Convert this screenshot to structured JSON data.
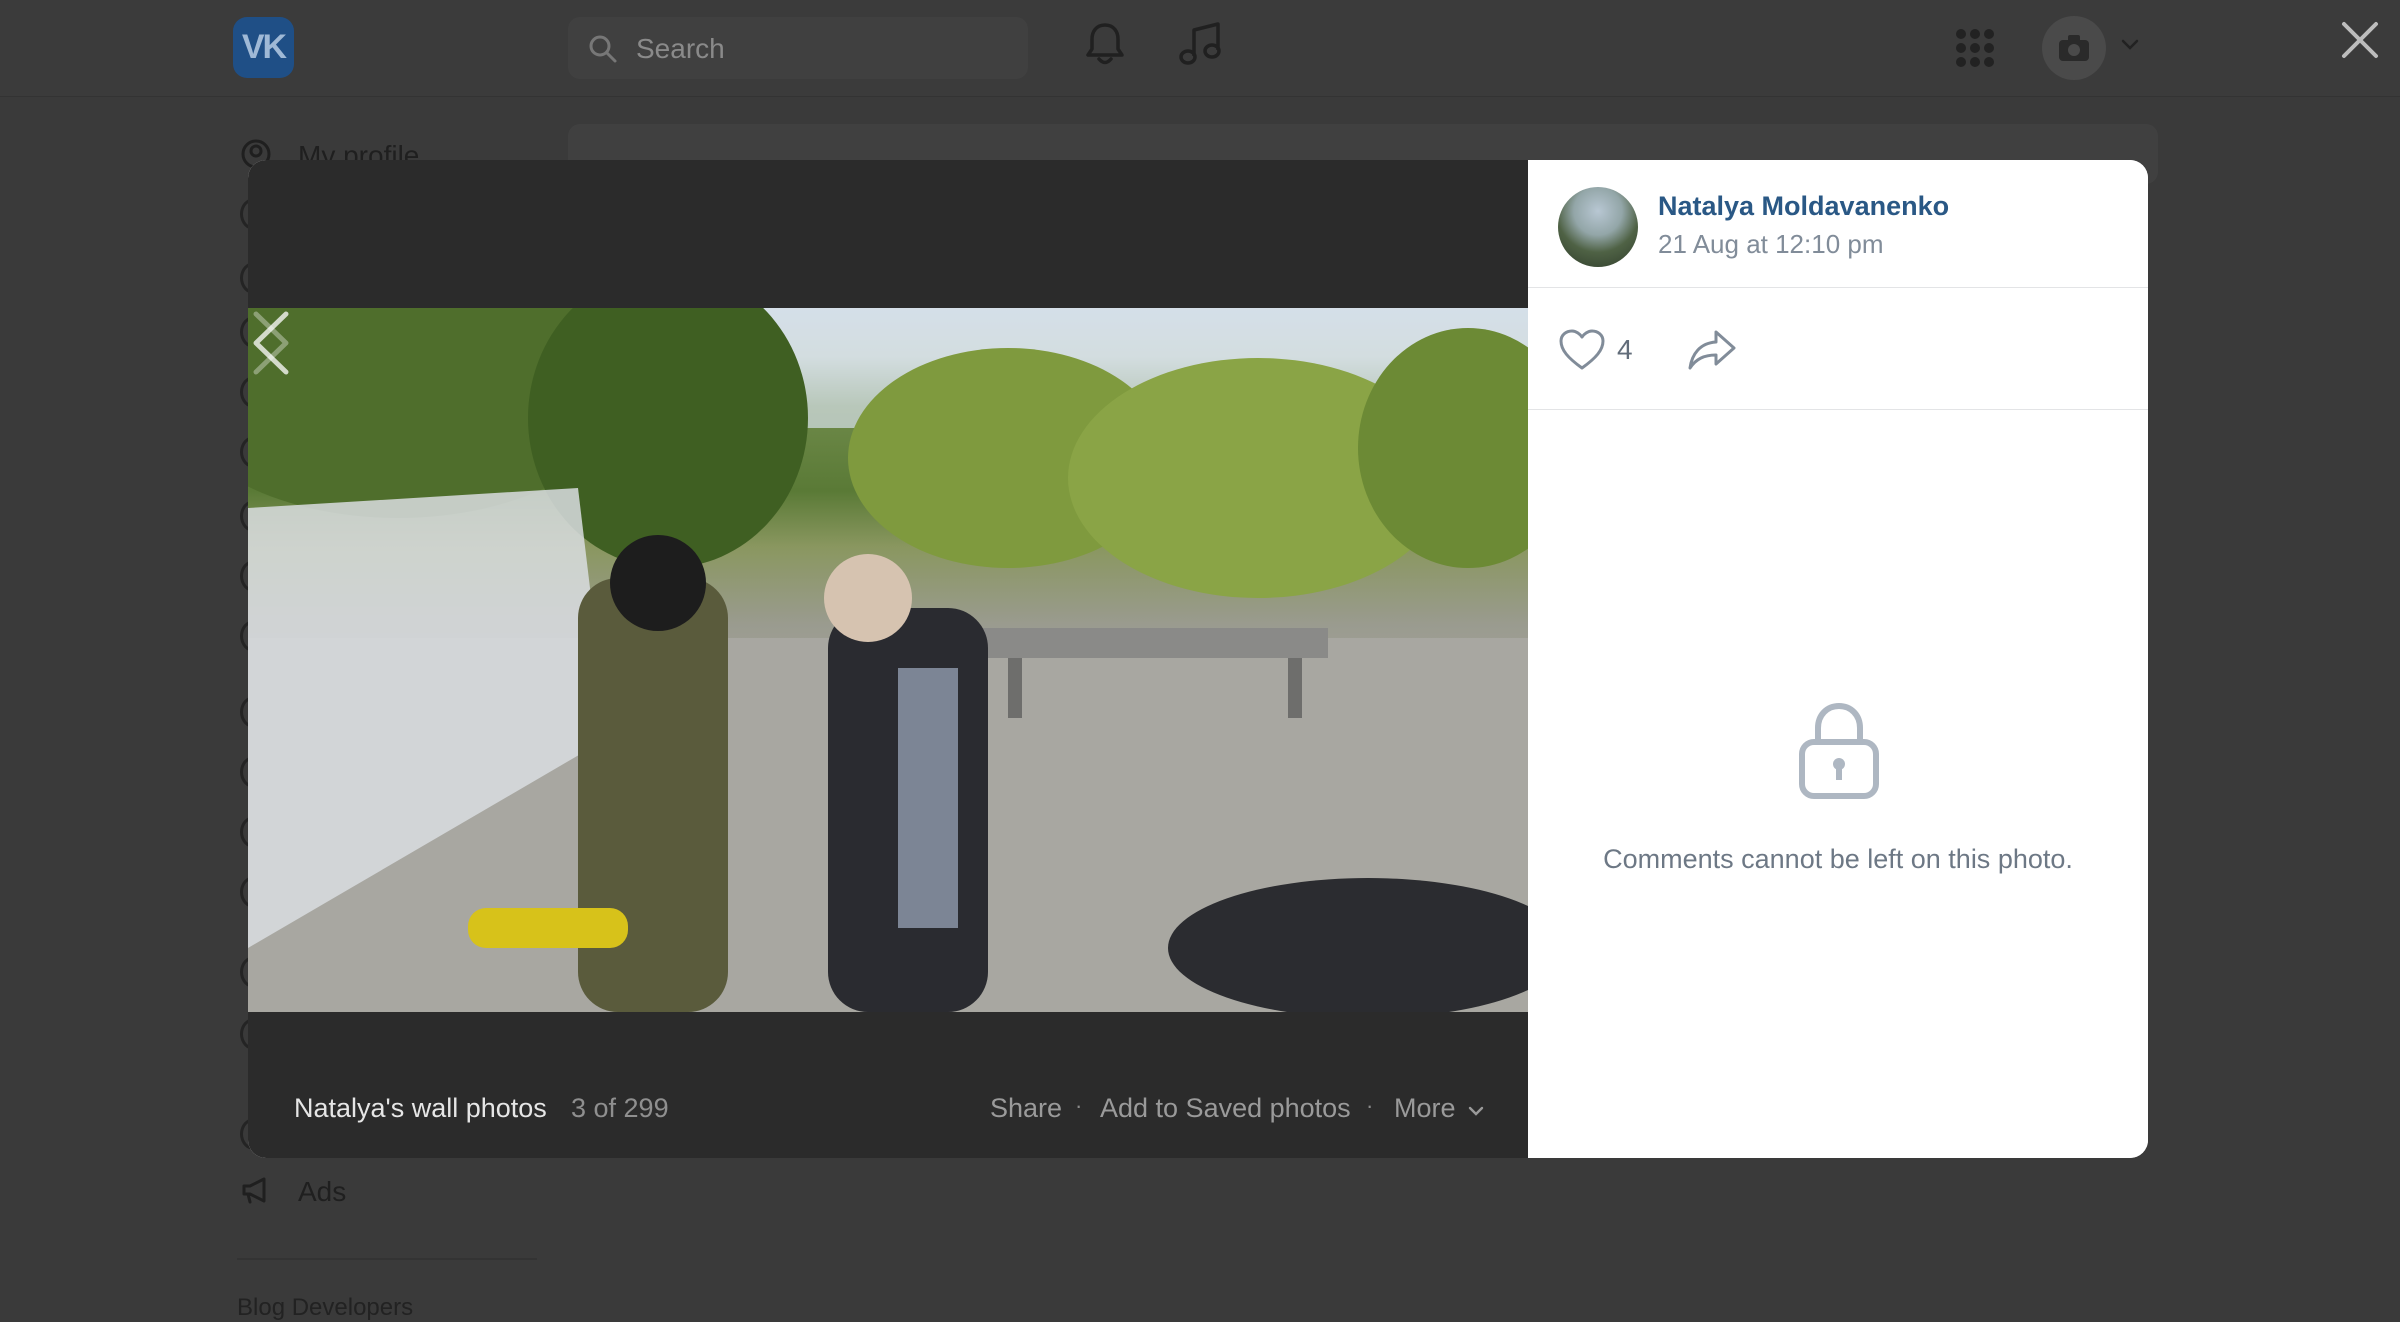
{
  "header": {
    "logo_text": "VK",
    "search_placeholder": "Search",
    "icons": [
      "notifications-bell-icon",
      "music-note-icon",
      "apps-grid-icon",
      "camera-icon",
      "chevron-down-icon",
      "close-icon"
    ]
  },
  "sidebar": {
    "items": [
      {
        "label": "My profile",
        "icon": "user-circle-icon"
      },
      {
        "label": "Ads",
        "icon": "megaphone-icon"
      }
    ],
    "footer_links": "Blog   Developers"
  },
  "viewer": {
    "album_title": "Natalya's wall photos",
    "position": "3 of 299",
    "actions": {
      "share": "Share",
      "add_to_saved": "Add to Saved photos",
      "more": "More"
    },
    "author": {
      "name": "Natalya Moldavanenko",
      "date": "21 Aug at 12:10 pm"
    },
    "likes": "4",
    "comments_locked_text": "Comments cannot be left on this photo."
  },
  "colors": {
    "link": "#2a5885",
    "muted": "#818c99",
    "overlay": "#3a3a3a"
  }
}
